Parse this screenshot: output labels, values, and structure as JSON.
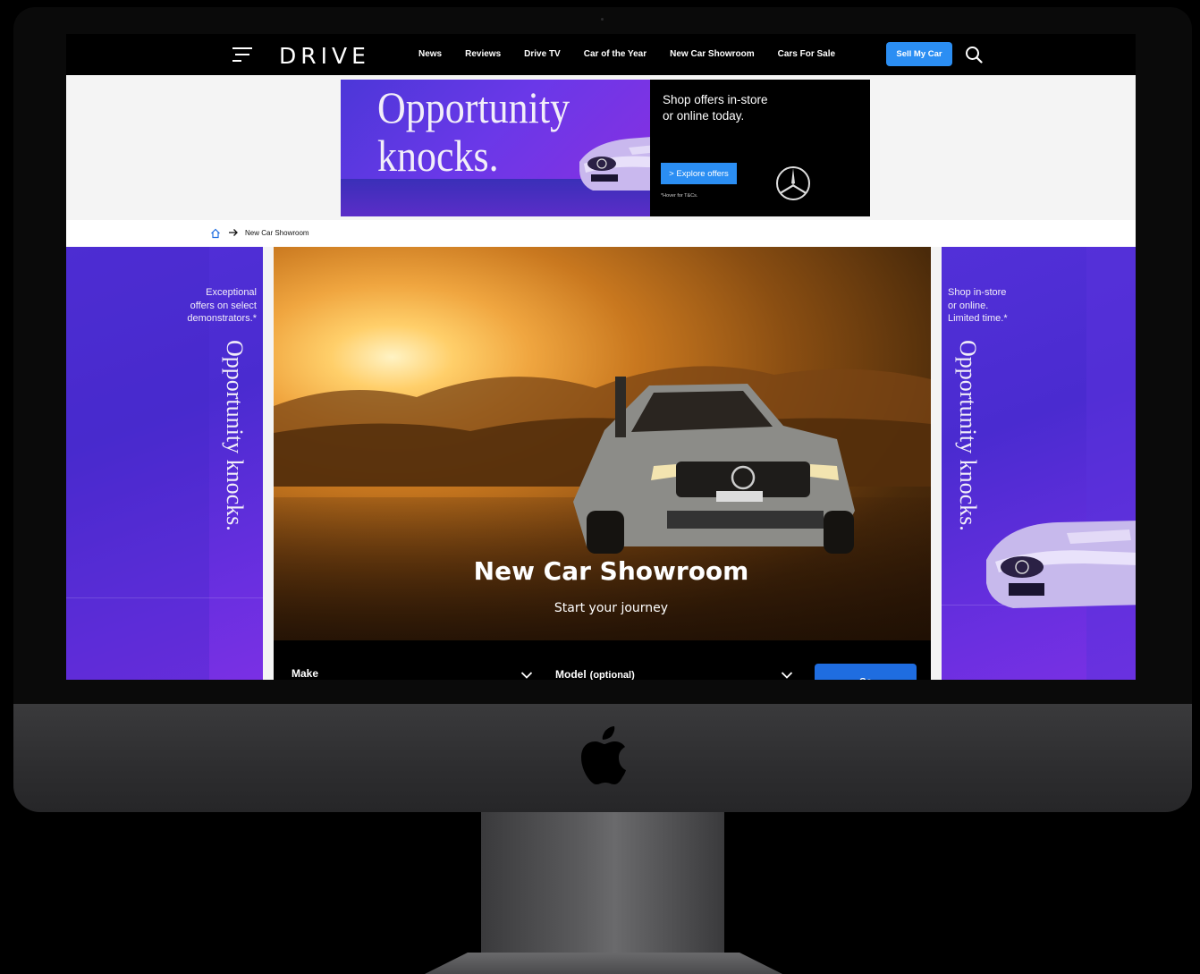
{
  "header": {
    "brand": "DRIVE",
    "nav": [
      "News",
      "Reviews",
      "Drive TV",
      "Car of the Year",
      "New Car Showroom",
      "Cars For Sale"
    ],
    "sell_button": "Sell My Car"
  },
  "top_ad": {
    "headline_line1": "Opportunity",
    "headline_line2": "knocks.",
    "copy_line1": "Shop offers in-store",
    "copy_line2": "or online today.",
    "cta": "> Explore offers",
    "tc": "*Hover for T&Cs."
  },
  "breadcrumb": {
    "current": "New Car Showroom"
  },
  "left_ad": {
    "copy_line1": "Exceptional",
    "copy_line2": "offers on select",
    "copy_line3": "demonstrators.*",
    "vertical": "Opportunity knocks."
  },
  "right_ad": {
    "copy_line1": "Shop in-store",
    "copy_line2": "or online.",
    "copy_line3": "Limited time.*",
    "vertical": "Opportunity knocks."
  },
  "hero": {
    "title": "New Car Showroom",
    "subtitle": "Start your journey"
  },
  "search": {
    "make_label": "Make",
    "model_label": "Model",
    "model_optional": "(optional)",
    "go": "Go"
  },
  "colors": {
    "accent_blue": "#2b8ef3",
    "go_blue": "#1f6de0",
    "ad_purple": "#5230d8"
  }
}
